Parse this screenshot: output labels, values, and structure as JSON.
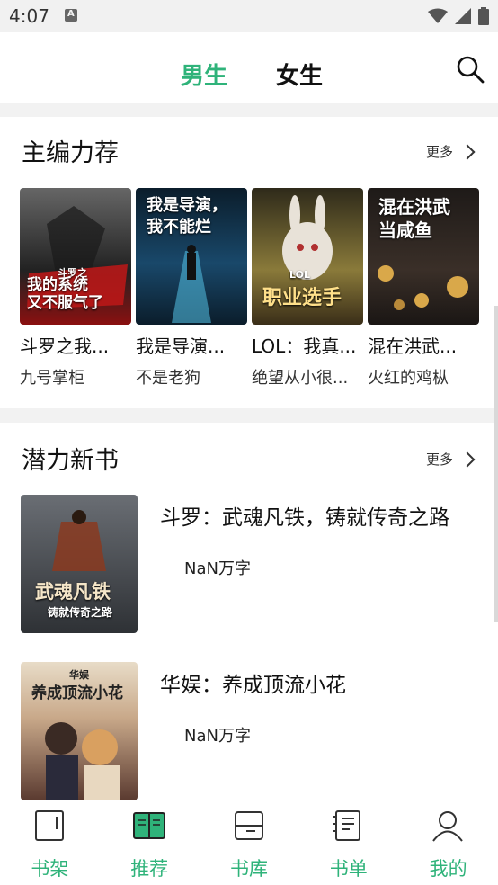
{
  "status": {
    "time": "4:07"
  },
  "tabs": [
    {
      "label": "男生",
      "active": true
    },
    {
      "label": "女生",
      "active": false
    }
  ],
  "colors": {
    "accent": "#2fb37a"
  },
  "recommend": {
    "title": "主编力荐",
    "more": "更多",
    "books": [
      {
        "title": "斗罗之我...",
        "author": "九号掌柜",
        "cover_text": "我的系统\n又不服气了",
        "cover_top": "斗罗之",
        "cover_color": "#3a3a3a"
      },
      {
        "title": "我是导演...",
        "author": "不是老狗",
        "cover_text": "我是导演，\n我不能烂",
        "cover_top": "",
        "cover_color": "#14324a"
      },
      {
        "title": "LOL：我真...",
        "author": "绝望从小很...",
        "cover_text": "职业选手",
        "cover_top": "LOL",
        "cover_color": "#6a5a2a"
      },
      {
        "title": "混在洪武...",
        "author": "火红的鸡枞",
        "cover_text": "混在洪武\n当咸鱼",
        "cover_top": "",
        "cover_color": "#2a2420"
      }
    ]
  },
  "new_books": {
    "title": "潜力新书",
    "more": "更多",
    "items": [
      {
        "title": "斗罗：武魂凡铁，铸就传奇之路",
        "words": "NaN万字",
        "cover_text": "武魂凡铁",
        "cover_sub": "铸就传奇之路",
        "cover_color": "#3b3f44"
      },
      {
        "title": "华娱：养成顶流小花",
        "words": "NaN万字",
        "cover_text": "养成顶流小花",
        "cover_sub": "华娱",
        "cover_color": "#4a3a36"
      }
    ]
  },
  "nav": [
    {
      "label": "书架",
      "icon": "bookshelf-icon"
    },
    {
      "label": "推荐",
      "icon": "book-open-icon"
    },
    {
      "label": "书库",
      "icon": "library-icon"
    },
    {
      "label": "书单",
      "icon": "booklist-icon"
    },
    {
      "label": "我的",
      "icon": "profile-icon"
    }
  ]
}
